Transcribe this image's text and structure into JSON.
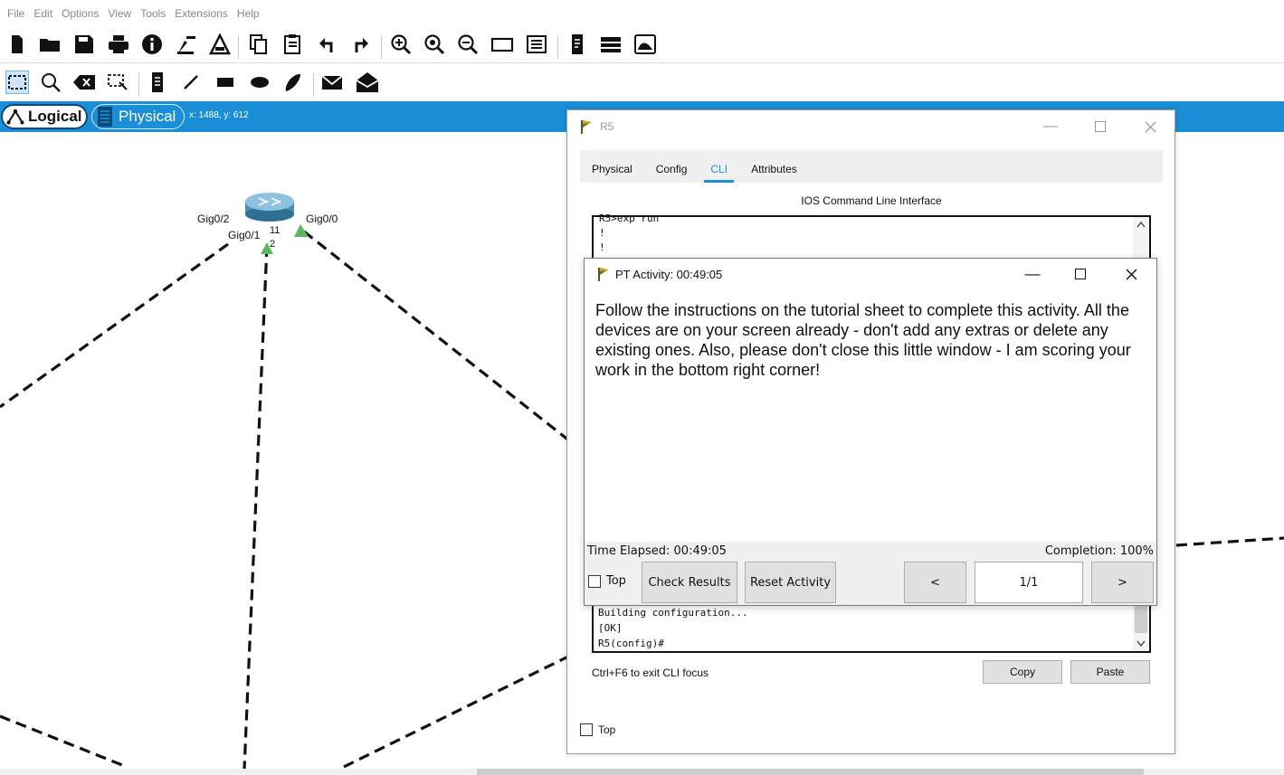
{
  "menu": [
    "File",
    "Edit",
    "Options",
    "View",
    "Tools",
    "Extensions",
    "Help"
  ],
  "viewbar": {
    "logical_label": "Logical",
    "physical_label": "Physical",
    "coords": "x: 1488, y: 612"
  },
  "topology": {
    "ports": {
      "gig02": "Gig0/2",
      "gig01": "Gig0/1",
      "gig00": "Gig0/0",
      "p11": "11",
      "p2": "2"
    }
  },
  "r5": {
    "title": "R5",
    "tabs": [
      "Physical",
      "Config",
      "CLI",
      "Attributes"
    ],
    "active_tab": "CLI",
    "panel_title": "IOS Command Line Interface",
    "cli_top_lines": [
      "R5>exp run",
      "!",
      "!"
    ],
    "cli_bottom_lines": [
      "Building configuration...",
      "[OK]",
      "R5(config)#"
    ],
    "hint": "Ctrl+F6 to exit CLI focus",
    "copy_label": "Copy",
    "paste_label": "Paste",
    "top_label": "Top"
  },
  "activity": {
    "title": "PT Activity: 00:49:05",
    "message": "Follow the instructions on the tutorial sheet to complete this activity.  All the devices are on your screen already - don't add any extras or delete any existing ones.  Also, please don't close this little window - I am scoring your work in the bottom right corner!",
    "time_elapsed": "Time Elapsed: 00:49:05",
    "completion": "Completion: 100%",
    "top_label": "Top",
    "check_results_label": "Check Results",
    "reset_activity_label": "Reset Activity",
    "prev_label": "<",
    "page": "1/1",
    "next_label": ">"
  },
  "colors": {
    "accent": "#1a8ed6",
    "link_green": "#5cb85c"
  }
}
